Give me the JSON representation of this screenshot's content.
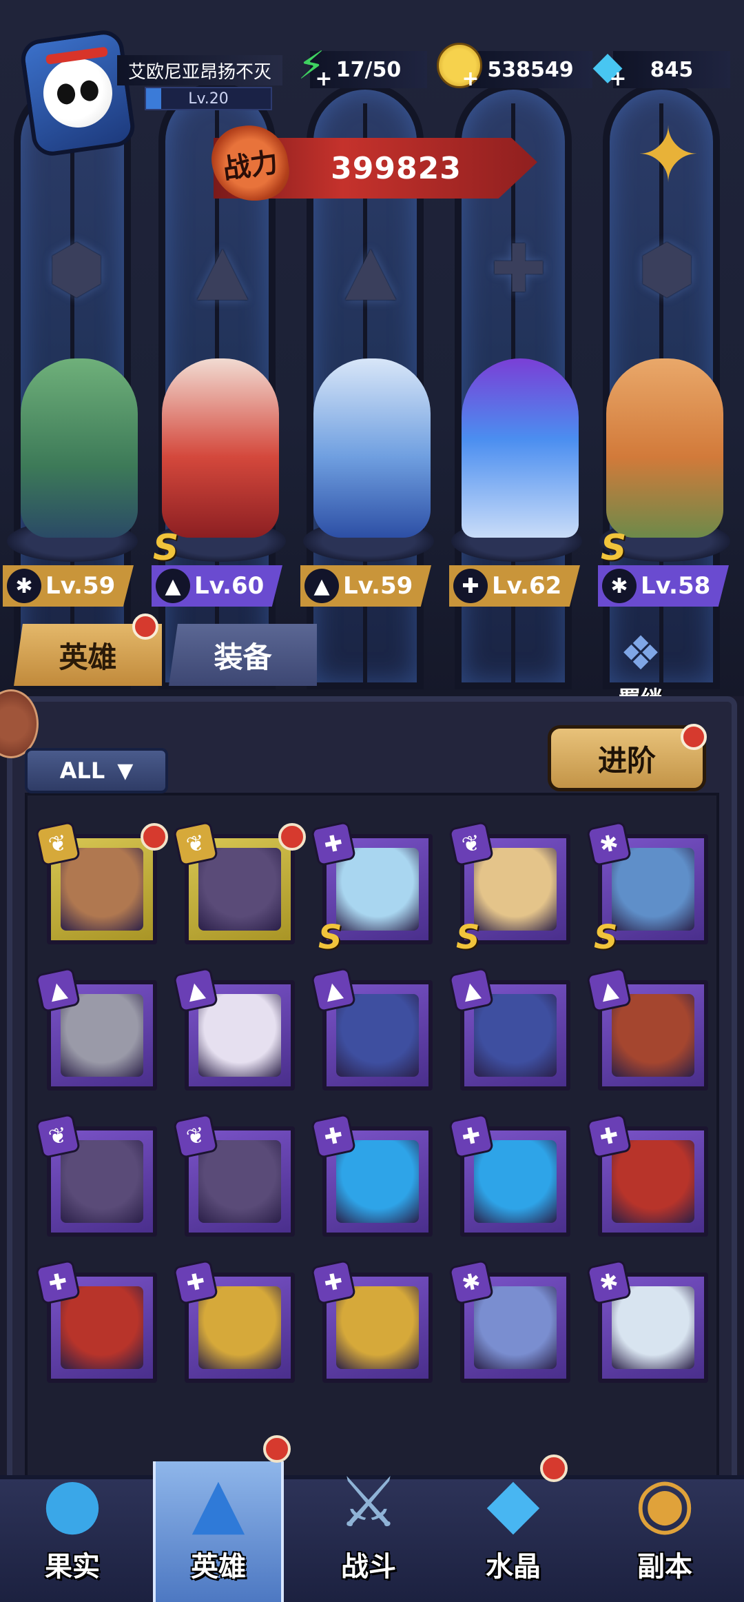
{
  "player": {
    "name": "艾欧尼亚昂扬不灭",
    "level": "Lv.20",
    "level_progress": 0.12
  },
  "resources": {
    "stamina": "17/50",
    "gold": "538549",
    "diamonds": "845"
  },
  "power": {
    "badge": "战力",
    "value": "399823"
  },
  "lineup": [
    {
      "level": "Lv.59",
      "class_icon": "claw-icon",
      "plate_color": "#c9953a",
      "rank_s": false
    },
    {
      "level": "Lv.60",
      "class_icon": "wizard-hat-icon",
      "plate_color": "#6a4bd0",
      "rank_s": true
    },
    {
      "level": "Lv.59",
      "class_icon": "wizard-hat-icon",
      "plate_color": "#c9953a",
      "rank_s": false
    },
    {
      "level": "Lv.62",
      "class_icon": "wrench-icon",
      "plate_color": "#c9953a",
      "rank_s": false
    },
    {
      "level": "Lv.58",
      "class_icon": "claw-icon",
      "plate_color": "#6a4bd0",
      "rank_s": true
    }
  ],
  "tabs": {
    "heroes": "英雄",
    "equipment": "装备"
  },
  "bond": {
    "label": "羁绊"
  },
  "filter": {
    "label": "ALL"
  },
  "advance": {
    "label": "进阶"
  },
  "roster": [
    {
      "frame": "gold",
      "class": "wing",
      "rank_s": false,
      "dot": true
    },
    {
      "frame": "gold",
      "class": "wing",
      "rank_s": false,
      "dot": true
    },
    {
      "frame": "purple",
      "class": "wrench",
      "rank_s": true,
      "dot": false
    },
    {
      "frame": "purple",
      "class": "wing",
      "rank_s": true,
      "dot": false
    },
    {
      "frame": "purple",
      "class": "claw",
      "rank_s": true,
      "dot": false
    },
    {
      "frame": "purple",
      "class": "hat",
      "rank_s": false,
      "dot": false
    },
    {
      "frame": "purple",
      "class": "hat",
      "rank_s": false,
      "dot": false
    },
    {
      "frame": "purple",
      "class": "hat",
      "rank_s": false,
      "dot": false
    },
    {
      "frame": "purple",
      "class": "hat",
      "rank_s": false,
      "dot": false
    },
    {
      "frame": "purple",
      "class": "hat",
      "rank_s": false,
      "dot": false
    },
    {
      "frame": "purple",
      "class": "wing",
      "rank_s": false,
      "dot": false
    },
    {
      "frame": "purple",
      "class": "wing",
      "rank_s": false,
      "dot": false
    },
    {
      "frame": "purple",
      "class": "wrench",
      "rank_s": false,
      "dot": false
    },
    {
      "frame": "purple",
      "class": "wrench",
      "rank_s": false,
      "dot": false
    },
    {
      "frame": "purple",
      "class": "wrench",
      "rank_s": false,
      "dot": false
    },
    {
      "frame": "purple",
      "class": "wrench",
      "rank_s": false,
      "dot": false
    },
    {
      "frame": "purple",
      "class": "wrench",
      "rank_s": false,
      "dot": false
    },
    {
      "frame": "purple",
      "class": "wrench",
      "rank_s": false,
      "dot": false
    },
    {
      "frame": "purple",
      "class": "claw",
      "rank_s": false,
      "dot": false
    },
    {
      "frame": "purple",
      "class": "claw",
      "rank_s": false,
      "dot": false
    }
  ],
  "nav": {
    "fruit": "果实",
    "heroes": "英雄",
    "battle": "战斗",
    "crystal": "水晶",
    "dungeon": "副本"
  },
  "colors": {
    "accent_gold": "#c9953a",
    "accent_purple": "#6a4bd0",
    "notification_red": "#d63a2e"
  }
}
